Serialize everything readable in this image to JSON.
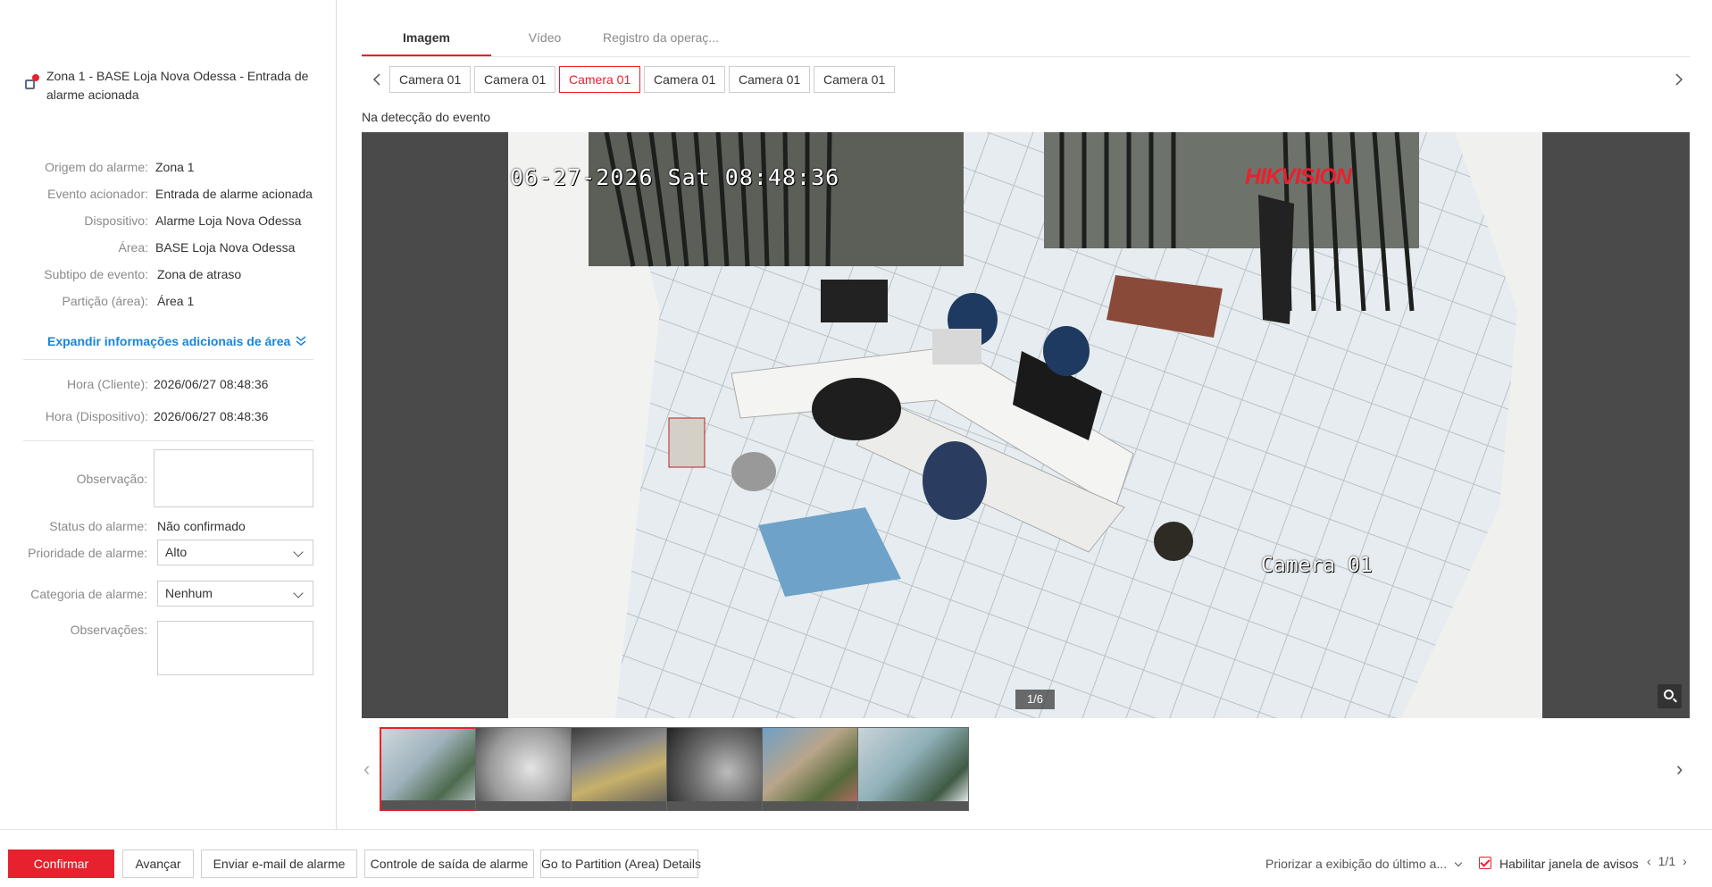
{
  "alarm": {
    "title": "Zona 1 - BASE Loja Nova Odessa - Entrada de alarme acionada",
    "details": [
      {
        "label": "Origem do alarme:",
        "value": "Zona 1"
      },
      {
        "label": "Evento acionador:",
        "value": "Entrada de alarme acionada"
      },
      {
        "label": "Dispositivo:",
        "value": "Alarme Loja Nova Odessa"
      },
      {
        "label": "Área:",
        "value": "BASE Loja Nova Odessa"
      },
      {
        "label": "Subtipo de evento:",
        "value": "Zona de atraso"
      },
      {
        "label": "Partição (área):",
        "value": "Área 1"
      }
    ],
    "expand_label": "Expandir informações adicionais de área",
    "times": [
      {
        "label": "Hora (Cliente):",
        "value": "2026/06/27 08:48:36"
      },
      {
        "label": "Hora (Dispositivo):",
        "value": "2026/06/27 08:48:36"
      }
    ],
    "observation_label": "Observação:",
    "status_label": "Status do alarme:",
    "status_value": "Não confirmado",
    "priority_label": "Prioridade de alarme:",
    "priority_value": "Alto",
    "category_label": "Categoria de alarme:",
    "category_value": "Nenhum",
    "notes_label": "Observações:"
  },
  "tabs": [
    "Imagem",
    "Vídeo",
    "Registro da operaç..."
  ],
  "cameras": [
    "Camera 01",
    "Camera 01",
    "Camera 01",
    "Camera 01",
    "Camera 01",
    "Camera 01"
  ],
  "event_label": "Na detecção do evento",
  "viewer": {
    "osd_time": "06-27-2026 Sat 08:48:36",
    "osd_camera": "Camera 01",
    "osd_logo": "HIKVISION",
    "page_indicator": "1/6"
  },
  "footer": {
    "confirm": "Confirmar",
    "next": "Avançar",
    "email": "Enviar e-mail de alarme",
    "output": "Controle de saída de alarme",
    "partition": "Go to Partition (Area) Details",
    "prioritize": "Priorizar a exibição do último a...",
    "enable_popup": "Habilitar janela de avisos",
    "pager": "1/1"
  },
  "colors": {
    "accent": "#e8212e",
    "link": "#1a86d8"
  }
}
